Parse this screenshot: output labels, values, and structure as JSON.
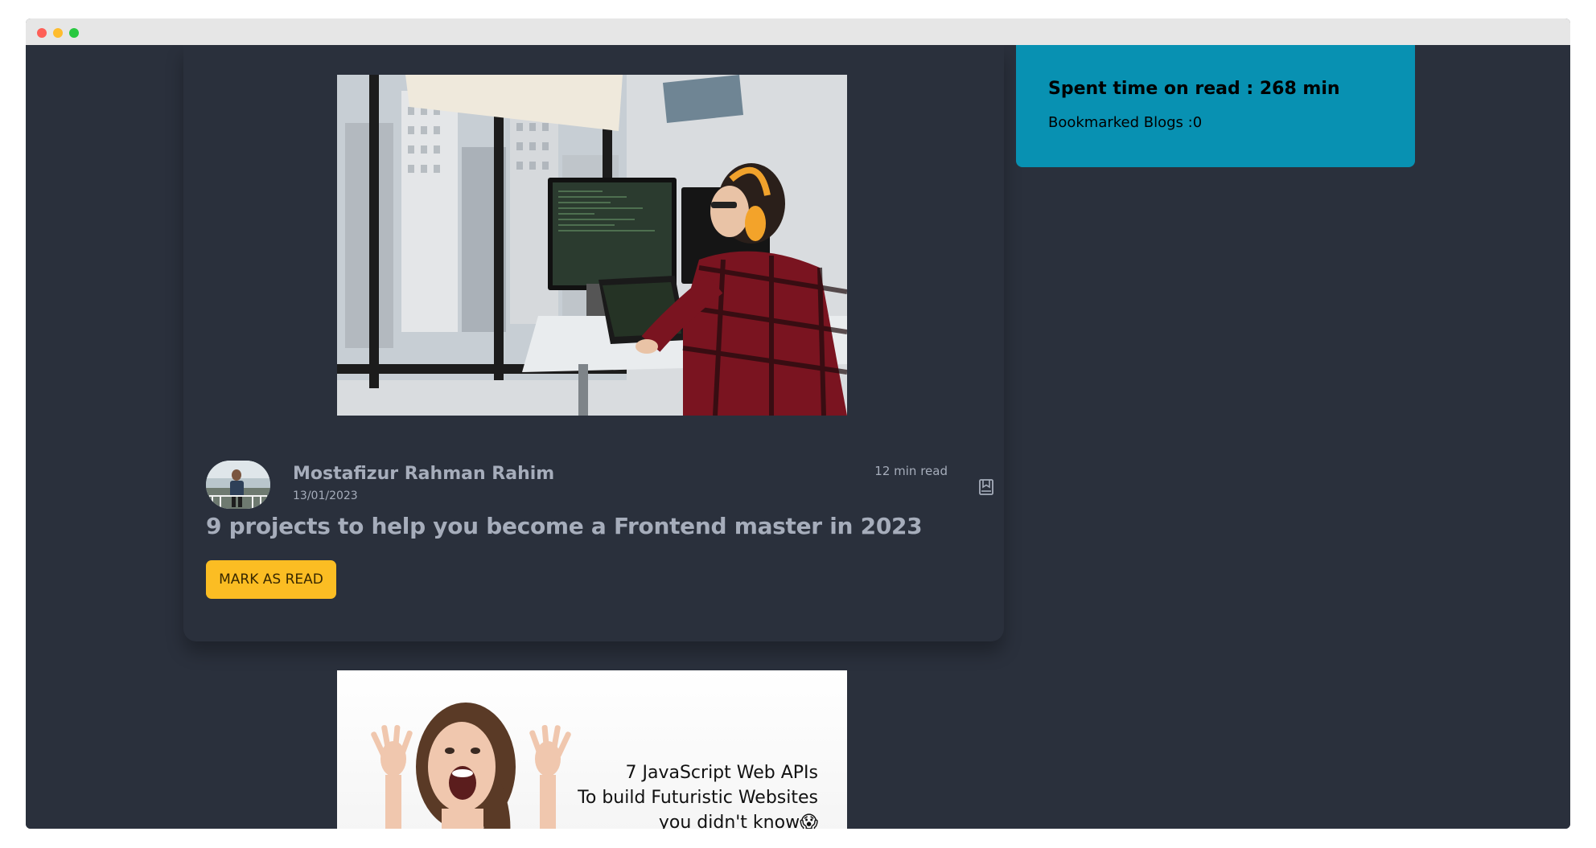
{
  "sidebar": {
    "spent_time_label": "Spent time on read : 268 min",
    "bookmarked_label": "Bookmarked Blogs :0"
  },
  "posts": [
    {
      "author_name": "Mostafizur Rahman Rahim",
      "date": "13/01/2023",
      "read_time": "12 min read",
      "title": "9 projects to help you become a Frontend master in 2023",
      "mark_read_label": "MARK AS READ",
      "bookmark_icon": "bookmark-icon"
    },
    {
      "cover_text": [
        "7 JavaScript Web APIs",
        "To build Futuristic Websites",
        "you didn't know😱"
      ]
    }
  ],
  "colors": {
    "page_bg": "#2a303c",
    "muted_text": "#a6adbb",
    "accent_button": "#fbbd23",
    "stats_panel": "#0891b2",
    "titlebar": "#e6e6e6"
  }
}
